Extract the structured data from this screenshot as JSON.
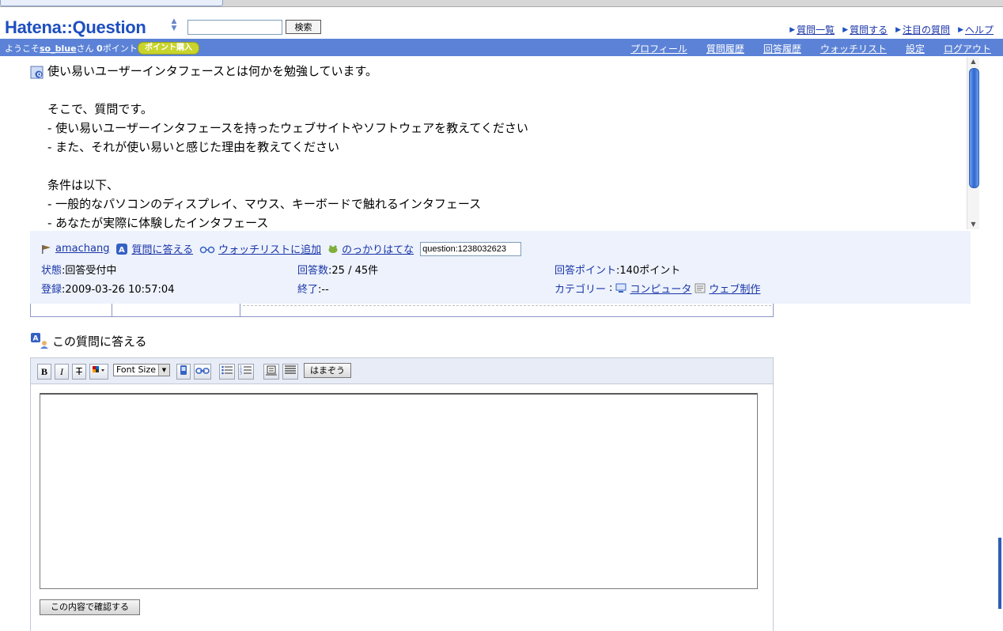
{
  "header": {
    "logo": "Hatena::Question",
    "search_placeholder": "",
    "search_button": "検索",
    "links": [
      "質問一覧",
      "質問する",
      "注目の質問",
      "ヘルプ"
    ]
  },
  "navbar": {
    "welcome_prefix": "ようこそ",
    "username": "so_blue",
    "welcome_suffix": "さん",
    "points_value": "0",
    "points_label": "ポイント",
    "buy_points": "ポイント購入",
    "links": [
      "プロフィール",
      "質問履歴",
      "回答履歴",
      "ウォッチリスト",
      "設定",
      "ログアウト"
    ]
  },
  "question": {
    "text": "使い易いユーザーインタフェースとは何かを勉強しています。\n\nそこで、質問です。\n- 使い易いユーザーインタフェースを持ったウェブサイトやソフトウェアを教えてください\n- また、それが使い易いと感じた理由を教えてください\n\n条件は以下、\n- 一般的なパソコンのディスプレイ、マウス、キーボードで触れるインタフェース\n- あなたが実際に体験したインタフェース"
  },
  "meta": {
    "author": "amachang",
    "answer_link": "質問に答える",
    "watchlist_link": "ウォッチリストに追加",
    "nokkari_link": "のっかりはてな",
    "question_id": "question:1238032623",
    "status_label": "状態",
    "status_value": "回答受付中",
    "answers_label": "回答数",
    "answers_value": "25 / 45件",
    "points_label": "回答ポイント",
    "points_value": "140ポイント",
    "registered_label": "登録",
    "registered_value": "2009-03-26 10:57:04",
    "end_label": "終了",
    "end_value": "--",
    "category_label": "カテゴリー",
    "categories": [
      "コンピュータ",
      "ウェブ制作"
    ]
  },
  "answer": {
    "title": "この質問に答える",
    "font_size_select": "Font Size",
    "hamazou_button": "はまぞう",
    "confirm_button": "この内容で確認する",
    "textarea_value": ""
  }
}
